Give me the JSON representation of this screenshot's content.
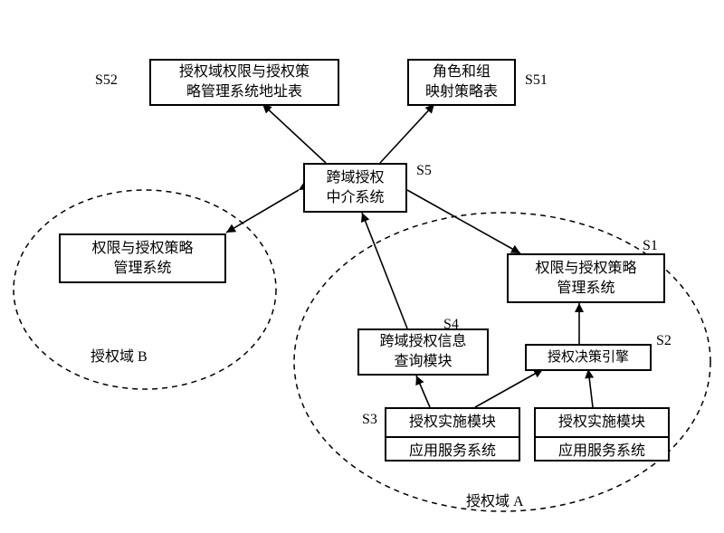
{
  "labels": {
    "s52": "S52",
    "s51": "S51",
    "s5": "S5",
    "s1": "S1",
    "s2": "S2",
    "s3": "S3",
    "s4": "S4",
    "domainA": "授权域 A",
    "domainB": "授权域 B"
  },
  "boxes": {
    "s52_l1": "授权域权限与授权策",
    "s52_l2": "略管理系统地址表",
    "s51_l1": "角色和组",
    "s51_l2": "映射策略表",
    "s5_l1": "跨域授权",
    "s5_l2": "中介系统",
    "b_pmgmt_l1": "权限与授权策略",
    "b_pmgmt_l2": "管理系统",
    "s1_l1": "权限与授权策略",
    "s1_l2": "管理系统",
    "s2": "授权决策引擎",
    "s4_l1": "跨域授权信息",
    "s4_l2": "查询模块",
    "s3_mod": "授权实施模块",
    "s3_app": "应用服务系统",
    "app2_mod": "授权实施模块",
    "app2_app": "应用服务系统"
  }
}
